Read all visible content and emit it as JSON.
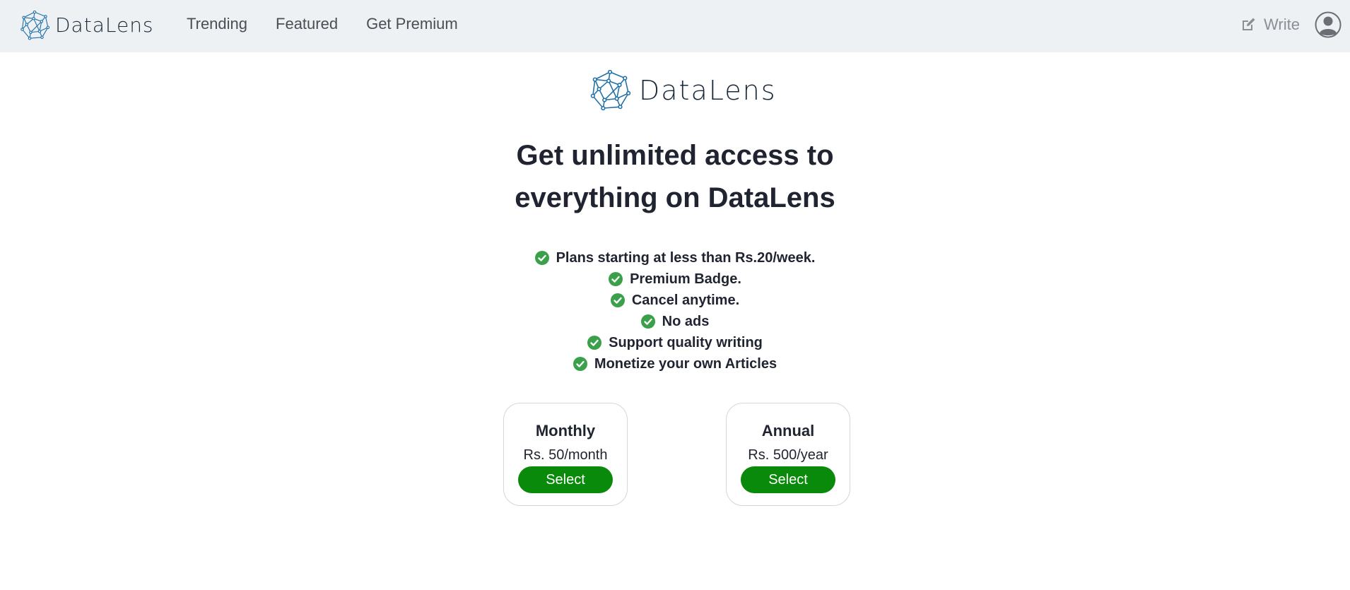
{
  "brand": {
    "name": "DataLens",
    "color": "#1f6fa8"
  },
  "nav": {
    "links": [
      {
        "label": "Trending"
      },
      {
        "label": "Featured"
      },
      {
        "label": "Get Premium"
      }
    ],
    "write_label": "Write",
    "write_icon": "pencil-square-icon",
    "avatar_icon": "user-circle-icon"
  },
  "main": {
    "headline_line1": "Get unlimited access to",
    "headline_line2": "everything on DataLens",
    "check_color": "#3aa04a",
    "features": [
      "Plans starting at less than Rs.20/week.",
      "Premium Badge.",
      "Cancel anytime.",
      "No ads",
      "Support quality writing",
      "Monetize your own Articles"
    ],
    "plans": [
      {
        "name": "Monthly",
        "price": "Rs. 50/month",
        "button": "Select"
      },
      {
        "name": "Annual",
        "price": "Rs. 500/year",
        "button": "Select"
      }
    ],
    "button_color": "#0a8a0a"
  }
}
